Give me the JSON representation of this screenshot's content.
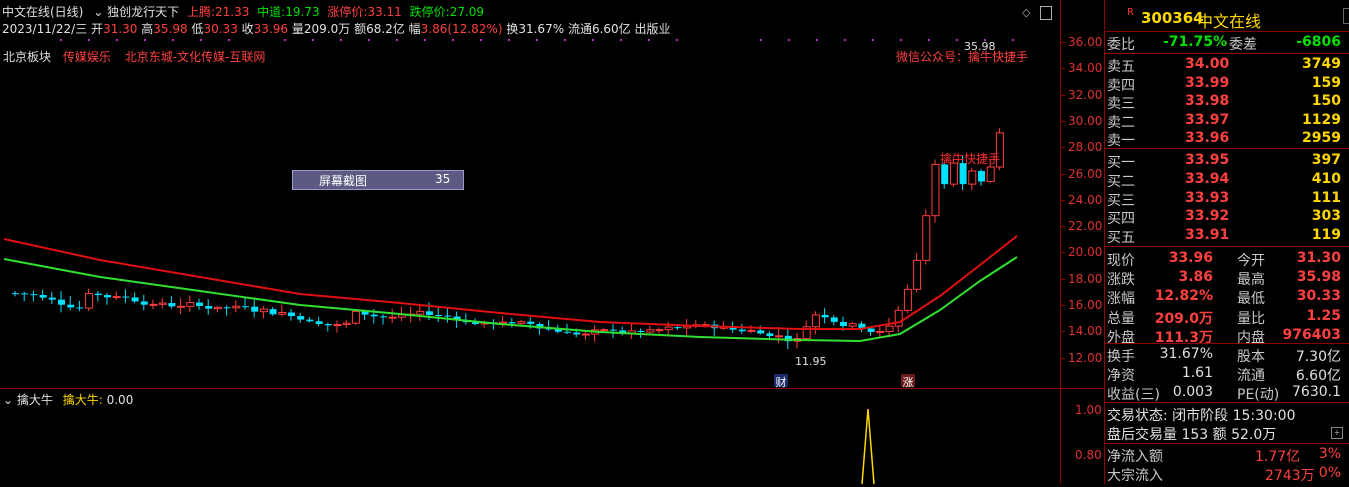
{
  "header": {
    "title": "中文在线(日线)",
    "indicator_name": "独创龙行天下",
    "up_label": "上腾:",
    "up_value": "21.33",
    "mid_label": "中道:",
    "mid_value": "19.73",
    "limit_up_label": "涨停价:",
    "limit_up_value": "33.11",
    "limit_down_label": "跌停价:",
    "limit_down_value": "27.09"
  },
  "ohlc_line": {
    "date": "2023/11/22/三",
    "open_label": "开",
    "open": "31.30",
    "high_label": "高",
    "high": "35.98",
    "low_label": "低",
    "low": "30.33",
    "close_label": "收",
    "close": "33.96",
    "vol_label": "量",
    "vol": "209.0万",
    "amt_label": "额",
    "amt": "68.2亿",
    "chg_label": "幅",
    "chg": "3.86(12.82%)",
    "turn_label": "换",
    "turn": "31.67%",
    "float_label": "流通",
    "float": "6.60亿",
    "sector": "出版业"
  },
  "tags": {
    "region": "北京板块",
    "concept": "传媒娱乐",
    "location": "北京东城-文化传媒-互联网",
    "wechat": "微信公众号：擒牛快捷手",
    "watermark": "擒牛快捷手"
  },
  "annotations": {
    "high_price": "35.98",
    "low_price": "11.95",
    "finance_marker": "财",
    "limit_marker": "涨"
  },
  "screenshot_tip": {
    "label": "屏幕截图",
    "value": "35"
  },
  "sub_indicator": {
    "name": "擒大牛",
    "label": "擒大牛:",
    "value": "0.00",
    "axis": [
      "1.00",
      "0.80"
    ]
  },
  "price_axis": [
    "36.00",
    "34.00",
    "32.00",
    "30.00",
    "28.00",
    "26.00",
    "24.00",
    "22.00",
    "20.00",
    "18.00",
    "16.00",
    "14.00",
    "12.00"
  ],
  "colors": {
    "up": "#ff3c3c",
    "down": "#00e0ff",
    "ma_red": "#e01010",
    "ma_green": "#30e030",
    "panel_line": "#8b0000"
  },
  "quote": {
    "code": "300364",
    "name": "中文在线",
    "r_badge": "R",
    "webi_label": "委比",
    "webi": "-71.75%",
    "wecha_label": "委差",
    "wecha": "-6806",
    "sells": [
      {
        "label": "卖五",
        "price": "34.00",
        "vol": "3749"
      },
      {
        "label": "卖四",
        "price": "33.99",
        "vol": "159"
      },
      {
        "label": "卖三",
        "price": "33.98",
        "vol": "150"
      },
      {
        "label": "卖二",
        "price": "33.97",
        "vol": "1129"
      },
      {
        "label": "卖一",
        "price": "33.96",
        "vol": "2959"
      }
    ],
    "buys": [
      {
        "label": "买一",
        "price": "33.95",
        "vol": "397"
      },
      {
        "label": "买二",
        "price": "33.94",
        "vol": "410"
      },
      {
        "label": "买三",
        "price": "33.93",
        "vol": "111"
      },
      {
        "label": "买四",
        "price": "33.92",
        "vol": "303"
      },
      {
        "label": "买五",
        "price": "33.91",
        "vol": "119"
      }
    ],
    "stats": [
      {
        "l1": "现价",
        "v1": "33.96",
        "l2": "今开",
        "v2": "31.30"
      },
      {
        "l1": "涨跌",
        "v1": "3.86",
        "l2": "最高",
        "v2": "35.98"
      },
      {
        "l1": "涨幅",
        "v1": "12.82%",
        "l2": "最低",
        "v2": "30.33"
      },
      {
        "l1": "总量",
        "v1": "209.0万",
        "l2": "量比",
        "v2": "1.25"
      },
      {
        "l1": "外盘",
        "v1": "111.3万",
        "l2": "内盘",
        "v2": "976403"
      }
    ],
    "stats2": [
      {
        "l1": "换手",
        "v1": "31.67%",
        "l2": "股本",
        "v2": "7.30亿"
      },
      {
        "l1": "净资",
        "v1": "1.61",
        "l2": "流通",
        "v2": "6.60亿"
      },
      {
        "l1": "收益(三)",
        "v1": "0.003",
        "l2": "PE(动)",
        "v2": "7630.1"
      }
    ],
    "trade_status": "交易状态: 闭市阶段 15:30:00",
    "after_hours": "盘后交易量 153 额 52.0万",
    "net_inflow_label": "净流入额",
    "net_inflow": "1.77亿",
    "net_inflow_pct": "3%",
    "block_inflow_label": "大宗流入",
    "block_inflow": "2743万",
    "block_inflow_pct": "0%"
  }
}
